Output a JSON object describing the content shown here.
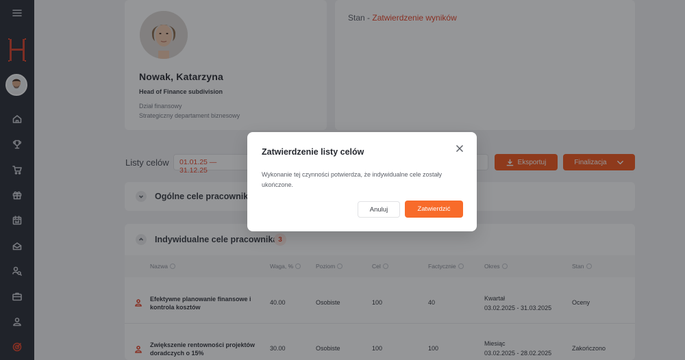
{
  "colors": {
    "accent": "#e8462b",
    "button": "#f3581e",
    "sidebar": "#2b2f37"
  },
  "sidebar": {
    "icons": [
      "menu-icon",
      "logo",
      "avatar",
      "home-icon",
      "trophy-icon",
      "cart-icon",
      "gift-icon",
      "calendar-icon",
      "box-icon",
      "search-person-icon",
      "briefcase-icon",
      "person-icon",
      "target-icon"
    ]
  },
  "profile": {
    "name": "Nowak, Katarzyna",
    "title": "Head of Finance subdivision",
    "department": "Dział finansowy",
    "division": "Strategiczny departament biznesowy"
  },
  "status": {
    "label": "Stan - ",
    "value": "Zatwierdzenie wyników"
  },
  "toolbar": {
    "goals_label": "Listy celów",
    "period": "01.01.25 — 31.12.25",
    "export_label": "Eksportuj",
    "finalize_label": "Finalizacja"
  },
  "sections": {
    "general": {
      "title": "Ogólne cele pracownika"
    },
    "individual": {
      "title": "Indywidualne cele pracownika",
      "count": "3"
    }
  },
  "table": {
    "headers": [
      "Nazwa",
      "Waga, %",
      "Poziom",
      "Cel",
      "Factycznie",
      "Okres",
      "Stan"
    ],
    "rows": [
      {
        "name": "Efektywne planowanie finansowe i kontrola kosztów",
        "weight": "40.00",
        "level": "Osobiste",
        "target": "100",
        "actual": "40",
        "period_type": "Kwartał",
        "period_range": "03.02.2025 - 31.03.2025",
        "state": "Oceny"
      },
      {
        "name": "Zwiększenie rentowności projektów doradczych o 15%",
        "weight": "30.00",
        "level": "Osobiste",
        "target": "100",
        "actual": "100",
        "period_type": "Miesiąc",
        "period_range": "03.02.2025 - 28.02.2025",
        "state": "Zakończono"
      }
    ]
  },
  "modal": {
    "title": "Zatwierdzenie listy celów",
    "text": "Wykonanie tej czynności potwierdza, że indywidualne cele zostały ukończone.",
    "cancel_label": "Anuluj",
    "confirm_label": "Zatwierdzić"
  }
}
